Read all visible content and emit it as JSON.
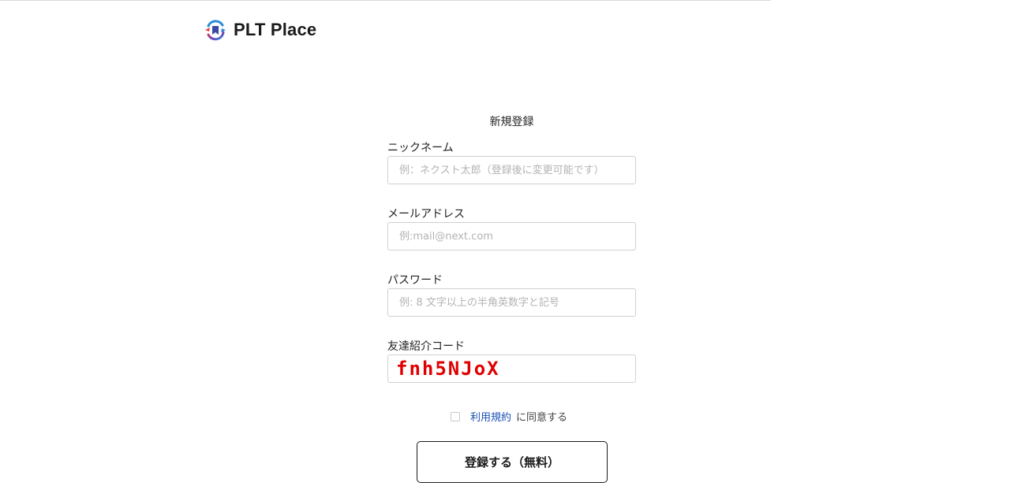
{
  "brand": {
    "name": "PLT Place",
    "logo_icon": "plt-place-logo-icon",
    "colors": {
      "ring_start": "#e8403f",
      "ring_mid": "#7b3fb5",
      "ring_end": "#2a8bd8",
      "bookmark": "#3a4aa8"
    }
  },
  "form": {
    "title": "新規登録",
    "nickname": {
      "label": "ニックネーム",
      "placeholder": "例：ネクスト太郎（登録後に変更可能です）",
      "value": ""
    },
    "email": {
      "label": "メールアドレス",
      "placeholder": "例:mail@next.com",
      "value": ""
    },
    "password": {
      "label": "パスワード",
      "placeholder": "例: 8 文字以上の半角英数字と記号",
      "value": ""
    },
    "referral": {
      "label": "友達紹介コード",
      "placeholder": "",
      "value": "fnh5NJoX",
      "color": "#e00000"
    },
    "agree": {
      "checked": false,
      "link_text": "利用規約",
      "suffix": "に同意する"
    },
    "submit_label": "登録する（無料）"
  }
}
